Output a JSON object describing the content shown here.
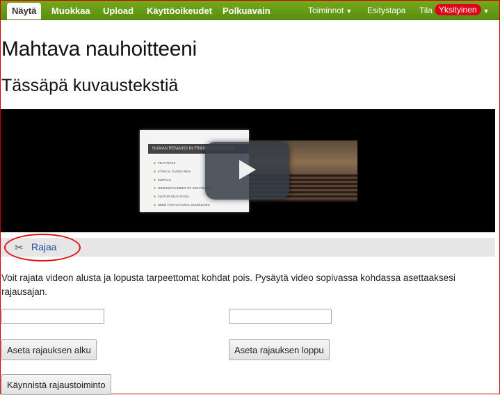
{
  "nav": {
    "items": [
      "Näytä",
      "Muokkaa",
      "Upload",
      "Käyttöoikeudet",
      "Polkuavain"
    ],
    "right": {
      "toiminnot": "Toiminnot",
      "esitystapa": "Esitystapa",
      "tila": "Tila",
      "tila_value": "Yksityinen"
    }
  },
  "page": {
    "title": "Mahtava nauhoitteeni",
    "subtitle": "Tässäpä kuvaustekstiä"
  },
  "video": {
    "slide_heading": "HUMAN REMAINS IN FINNISH MUSEUMS",
    "slide_items": [
      "PRACTICES",
      "ETHICAL GUIDELINES",
      "BURIALS",
      "MINIMUM NUMBER OF INDIVIDUALS",
      "VISITOR REACTIONS",
      "NEED FOR NATIONAL GUIDELINES"
    ]
  },
  "trim": {
    "link_label": "Rajaa",
    "description": "Voit rajata videon alusta ja lopusta tarpeettomat kohdat pois. Pysäytä video sopivassa kohdassa asettaaksesi rajausajan.",
    "start_value": "",
    "end_value": "",
    "set_start_label": "Aseta rajauksen alku",
    "set_end_label": "Aseta rajauksen loppu",
    "run_label": "Käynnistä rajaustoiminto"
  },
  "colors": {
    "nav_green": "#65a014",
    "badge_red": "#e0001b",
    "highlight_ring": "#e01010",
    "link_blue": "#1f4e99"
  }
}
